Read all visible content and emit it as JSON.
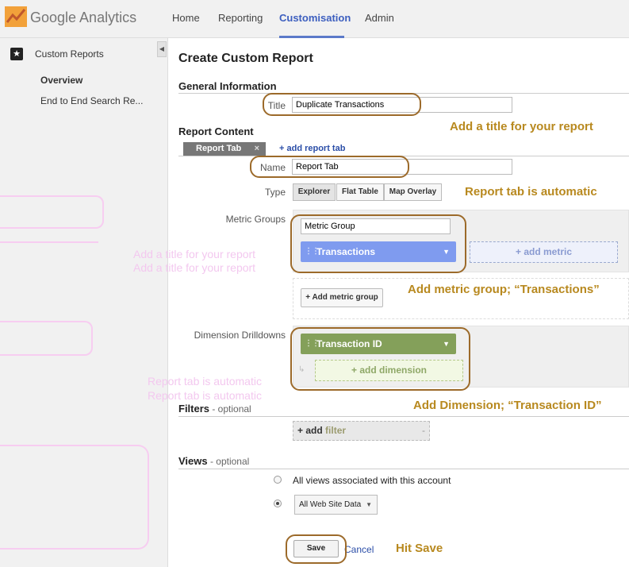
{
  "app": {
    "name": "Google Analytics"
  },
  "nav": {
    "items": [
      {
        "label": "Home"
      },
      {
        "label": "Reporting"
      },
      {
        "label": "Customisation",
        "active": true
      },
      {
        "label": "Admin"
      }
    ]
  },
  "sidebar": {
    "title": "Custom Reports",
    "items": [
      {
        "label": "Overview",
        "selected": true
      },
      {
        "label": "End to End Search Re..."
      }
    ]
  },
  "page": {
    "title": "Create Custom Report"
  },
  "general": {
    "heading": "General Information",
    "title_label": "Title",
    "title_value": "Duplicate Transactions"
  },
  "content": {
    "heading": "Report Content",
    "tab_label": "Report Tab",
    "tab_close": "×",
    "add_tab": "+ add report tab",
    "name_label": "Name",
    "name_value": "Report Tab",
    "type_label": "Type",
    "types": [
      "Explorer",
      "Flat Table",
      "Map Overlay"
    ],
    "selected_type": "Explorer",
    "metric_groups_label": "Metric Groups",
    "metric_group_name": "Metric Group",
    "metric": "Transactions",
    "add_metric": "+ add metric",
    "add_metric_group": "+ Add metric group",
    "dimension_label": "Dimension Drilldowns",
    "dimension": "Transaction ID",
    "add_dimension": "+ add dimension"
  },
  "filters": {
    "heading": "Filters",
    "optional": " - optional",
    "add_plus": "+ add",
    "add_word": "filter",
    "dash": "-"
  },
  "views": {
    "heading": "Views",
    "optional": " - optional",
    "option_all": "All views associated with this account",
    "option_selected": "All Web Site Data",
    "selected_index": 1
  },
  "actions": {
    "save": "Save",
    "cancel": "Cancel"
  },
  "annotations": {
    "title_note": "Add a title for your report",
    "tab_note": "Report tab is automatic",
    "metric_note": "Add metric group; “Transactions”",
    "dimension_note": "Add Dimension; “Transaction ID”",
    "save_note": "Hit Save"
  },
  "ghosts": {
    "g1": "Add a title for your report",
    "g2": "Add a title for your report",
    "g3": "Report tab is automatic",
    "g4": "Report tab is automatic"
  },
  "colors": {
    "accent_nav": "#3d5fbf",
    "metric_chip": "#7f9bef",
    "dimension_chip": "#84a05a",
    "annotation_text": "#b8891f",
    "annotation_outline": "#9c6a2a"
  },
  "icons": {
    "logo": "analytics-logo-icon",
    "custom_reports": "star-report-icon",
    "collapse": "collapse-arrow-icon"
  }
}
